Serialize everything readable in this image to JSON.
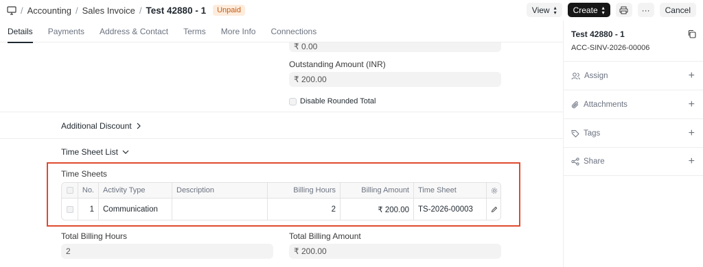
{
  "breadcrumbs": [
    "Accounting",
    "Sales Invoice"
  ],
  "doc_title": "Test 42880 - 1",
  "status_badge": "Unpaid",
  "actions": {
    "view": "View",
    "create": "Create",
    "more": "···",
    "cancel": "Cancel"
  },
  "tabs": [
    "Details",
    "Payments",
    "Address & Contact",
    "Terms",
    "More Info",
    "Connections"
  ],
  "form": {
    "top_value": "₹ 0.00",
    "outstanding_label": "Outstanding Amount (INR)",
    "outstanding_value": "₹ 200.00",
    "disable_rounded_label": "Disable Rounded Total",
    "additional_discount": "Additional Discount",
    "time_sheet_list": "Time Sheet List",
    "time_sheets_label": "Time Sheets",
    "total_billing_hours_label": "Total Billing Hours",
    "total_billing_hours_value": "2",
    "total_billing_amount_label": "Total Billing Amount",
    "total_billing_amount_value": "₹ 200.00"
  },
  "grid": {
    "headers": [
      "No.",
      "Activity Type",
      "Description",
      "Billing Hours",
      "Billing Amount",
      "Time Sheet"
    ],
    "rows": [
      {
        "no": "1",
        "activity_type": "Communication",
        "description": "",
        "billing_hours": "2",
        "billing_amount": "₹ 200.00",
        "time_sheet": "TS-2026-00003"
      }
    ]
  },
  "sidebar": {
    "title": "Test 42880 - 1",
    "name": "ACC-SINV-2026-00006",
    "sections": [
      "Assign",
      "Attachments",
      "Tags",
      "Share"
    ]
  }
}
